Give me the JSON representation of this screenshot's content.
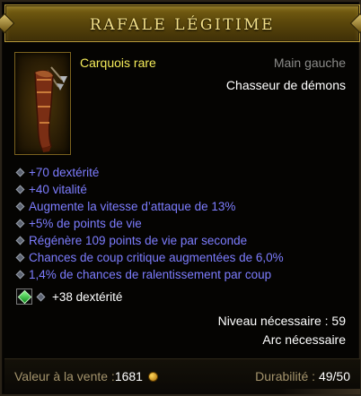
{
  "header": {
    "title": "RAFALE LÉGITIME"
  },
  "item": {
    "icon": "quiver-icon",
    "type": "Carquois rare",
    "slot": "Main gauche",
    "class_requirement": "Chasseur de démons",
    "affixes": [
      "+70 dextérité",
      "+40 vitalité",
      "Augmente la vitesse d’attaque de 13%",
      "+5% de points de vie",
      "Régénère 109 points de vie par seconde",
      "Chances de coup critique augmentées de 6,0%",
      "1,4% de chances de ralentissement par coup"
    ],
    "socket": {
      "gem_icon": "emerald-gem-icon",
      "bonus": "+38 dextérité"
    },
    "level_requirement": "Niveau nécessaire : 59",
    "skill_requirement": "Arc nécessaire"
  },
  "footer": {
    "sell_label": "Valeur à la vente : ",
    "sell_value": "1681",
    "currency_icon": "gold-coin-icon",
    "durability_label": "Durabilité : ",
    "durability_value": "49/50"
  },
  "colors": {
    "rare_yellow": "#f5ec5a",
    "magic_blue": "#7d7dff",
    "header_gold": "#f3e08a",
    "label_tan": "#a4946c"
  }
}
